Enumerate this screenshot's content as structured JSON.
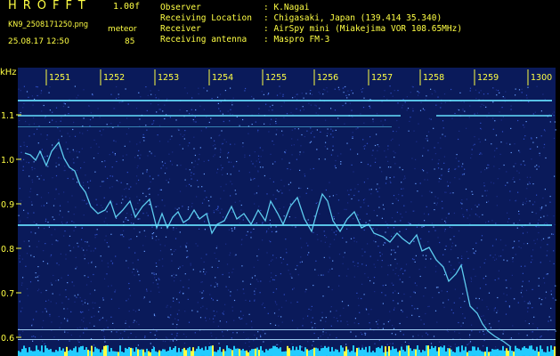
{
  "header": {
    "title": "HROFFT",
    "version": "1.00f",
    "filename": "KN9_2508171250.png",
    "mode": "meteor",
    "timestamp": "25.08.17 12:50",
    "count": "85",
    "fields": [
      {
        "label": "Observer",
        "value": ": K.Nagai"
      },
      {
        "label": "Receiving Location",
        "value": ": Chigasaki, Japan (139.414 35.340)"
      },
      {
        "label": "Receiver",
        "value": ": AirSpy mini (Miakejima VOR 108.65MHz)"
      },
      {
        "label": "Receiving antenna",
        "value": ": Maspro FM-3"
      }
    ]
  },
  "plot": {
    "y_unit": "kHz",
    "y_ticks": [
      "1.1",
      "1.0",
      "0.9",
      "0.8",
      "0.7",
      "0.6"
    ],
    "x_ticks": [
      "1251",
      "1252",
      "1253",
      "1254",
      "1255",
      "1256",
      "1257",
      "1258",
      "1259",
      "1300"
    ],
    "colors": {
      "background": "#0a1a5a",
      "signal": "#66e0ff",
      "text": "#ffff44"
    }
  }
}
